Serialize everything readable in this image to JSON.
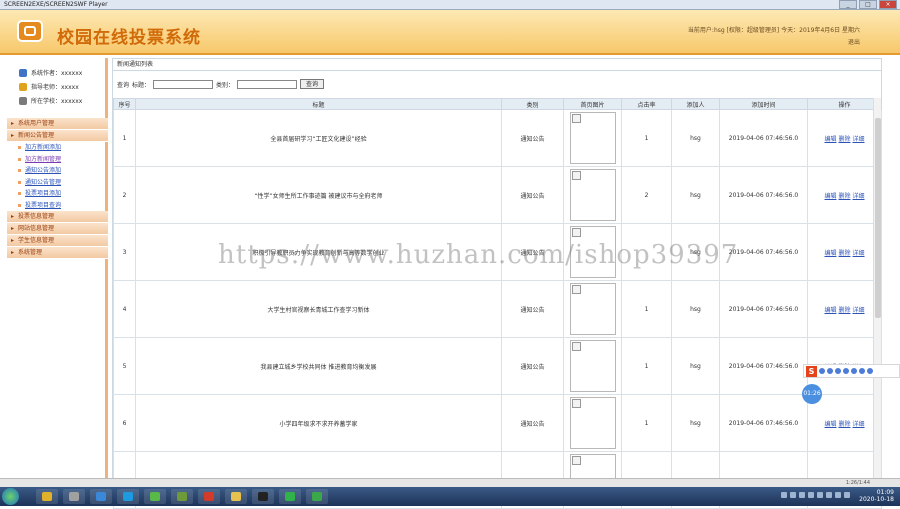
{
  "window": {
    "title": "SCREEN2EXE/SCREEN2SWF Player"
  },
  "app": {
    "title": "校园在线投票系统",
    "user_info": "当前用户:hsg [权限：超级管理员] 今天：2019年4月6日 星期六",
    "logout": "退出"
  },
  "sidebar": {
    "info": [
      {
        "label": "系统作者：xxxxxx",
        "icon": "user-icon",
        "color": "#3e73c8"
      },
      {
        "label": "指导老师：xxxxx",
        "icon": "teacher-icon",
        "color": "#e0a21a"
      },
      {
        "label": "所在学校：xxxxxx",
        "icon": "school-icon",
        "color": "#7a7a7a"
      }
    ],
    "menu": [
      {
        "type": "group",
        "label": "系统用户管理"
      },
      {
        "type": "group",
        "label": "新闻公告管理"
      },
      {
        "type": "sub",
        "label": "加方新闻添加"
      },
      {
        "type": "sub",
        "label": "加方新闻管理"
      },
      {
        "type": "sub",
        "label": "通知公告添加"
      },
      {
        "type": "sub",
        "label": "通知公告管理"
      },
      {
        "type": "sub",
        "label": "投票项目添加"
      },
      {
        "type": "sub",
        "label": "投票项目查询"
      },
      {
        "type": "group",
        "label": "投票信息管理"
      },
      {
        "type": "group",
        "label": "网站信息管理"
      },
      {
        "type": "group",
        "label": "学生信息管理"
      },
      {
        "type": "group",
        "label": "系统管理"
      }
    ]
  },
  "main": {
    "breadcrumb": "新闻通知列表",
    "search": {
      "label": "查询",
      "title_label": "标题：",
      "category_label": "类别：",
      "button": "查询",
      "title_value": "",
      "category_value": ""
    },
    "columns": [
      "序号",
      "标题",
      "类别",
      "首页图片",
      "点击率",
      "添加人",
      "添加时间",
      "操作"
    ],
    "rows": [
      {
        "no": "1",
        "title": "全县首届研学习“工匠文化建设”经验",
        "category": "通知公告",
        "clicks": "1",
        "adder": "hsg",
        "time": "2019-04-06 07:46:56.0"
      },
      {
        "no": "2",
        "title": "“性学”女师生所工作事迹篇 被建议市与全府老师",
        "category": "通知公告",
        "clicks": "2",
        "adder": "hsg",
        "time": "2019-04-06 07:46:56.0"
      },
      {
        "no": "3",
        "title": "积极引导教职员力争实现教育创新与高等数学创业",
        "category": "通知公告",
        "clicks": "",
        "adder": "hsg",
        "time": "2019-04-06 07:46:56.0"
      },
      {
        "no": "4",
        "title": "大学生村官视察长青城工作查学习新体",
        "category": "通知公告",
        "clicks": "1",
        "adder": "hsg",
        "time": "2019-04-06 07:46:56.0"
      },
      {
        "no": "5",
        "title": "我县建立城乡学校共同体 推进教育均衡发展",
        "category": "通知公告",
        "clicks": "1",
        "adder": "hsg",
        "time": "2019-04-06 07:46:56.0"
      },
      {
        "no": "6",
        "title": "小学四年级求不求开养蓄学家",
        "category": "通知公告",
        "clicks": "1",
        "adder": "hsg",
        "time": "2019-04-06 07:46:56.0"
      },
      {
        "no": "",
        "title": "",
        "category": "",
        "clicks": "",
        "adder": "",
        "time": ""
      }
    ],
    "ops": {
      "edit": "编辑",
      "delete": "删除",
      "detail": "详细"
    }
  },
  "overlay": {
    "watermark": "https://www.huzhan.com/ishop39397",
    "ime_badge": "S",
    "bubble": "01:26"
  },
  "player": {
    "time": "1:26/1:44"
  },
  "taskbar": {
    "time": "01:09",
    "date": "2020-10-18"
  }
}
